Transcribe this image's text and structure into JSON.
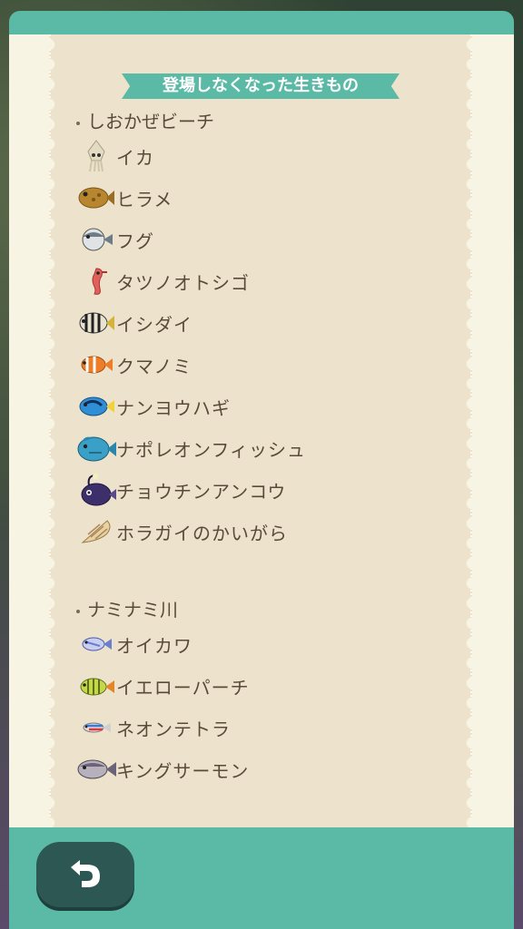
{
  "banner": {
    "title": "登場しなくなった生きもの"
  },
  "sections": [
    {
      "title": "しおかぜビーチ",
      "items": [
        {
          "label": "イカ",
          "icon": "squid-icon",
          "color": "#d9d3b8"
        },
        {
          "label": "ヒラメ",
          "icon": "flounder-icon",
          "color": "#b8862f"
        },
        {
          "label": "フグ",
          "icon": "pufferfish-icon",
          "color": "#8a9aa6"
        },
        {
          "label": "タツノオトシゴ",
          "icon": "seahorse-icon",
          "color": "#d9574f"
        },
        {
          "label": "イシダイ",
          "icon": "striped-beakfish-icon",
          "color": "#333333"
        },
        {
          "label": "クマノミ",
          "icon": "clownfish-icon",
          "color": "#e8762a"
        },
        {
          "label": "ナンヨウハギ",
          "icon": "blue-tang-icon",
          "color": "#2f8ed6"
        },
        {
          "label": "ナポレオンフィッシュ",
          "icon": "napoleonfish-icon",
          "color": "#3aa0c8"
        },
        {
          "label": "チョウチンアンコウ",
          "icon": "anglerfish-icon",
          "color": "#3c2f6a"
        },
        {
          "label": "ホラガイのかいがら",
          "icon": "triton-shell-icon",
          "color": "#c9a36a"
        }
      ]
    },
    {
      "title": "ナミナミ川",
      "items": [
        {
          "label": "オイカワ",
          "icon": "pale-chub-icon",
          "color": "#6b7fd0"
        },
        {
          "label": "イエローパーチ",
          "icon": "yellow-perch-icon",
          "color": "#9fb836"
        },
        {
          "label": "ネオンテトラ",
          "icon": "neon-tetra-icon",
          "color": "#3a8fd9"
        },
        {
          "label": "キングサーモン",
          "icon": "king-salmon-icon",
          "color": "#7a6d7a"
        }
      ]
    }
  ],
  "back_button": {
    "icon": "back-arrow-icon"
  }
}
